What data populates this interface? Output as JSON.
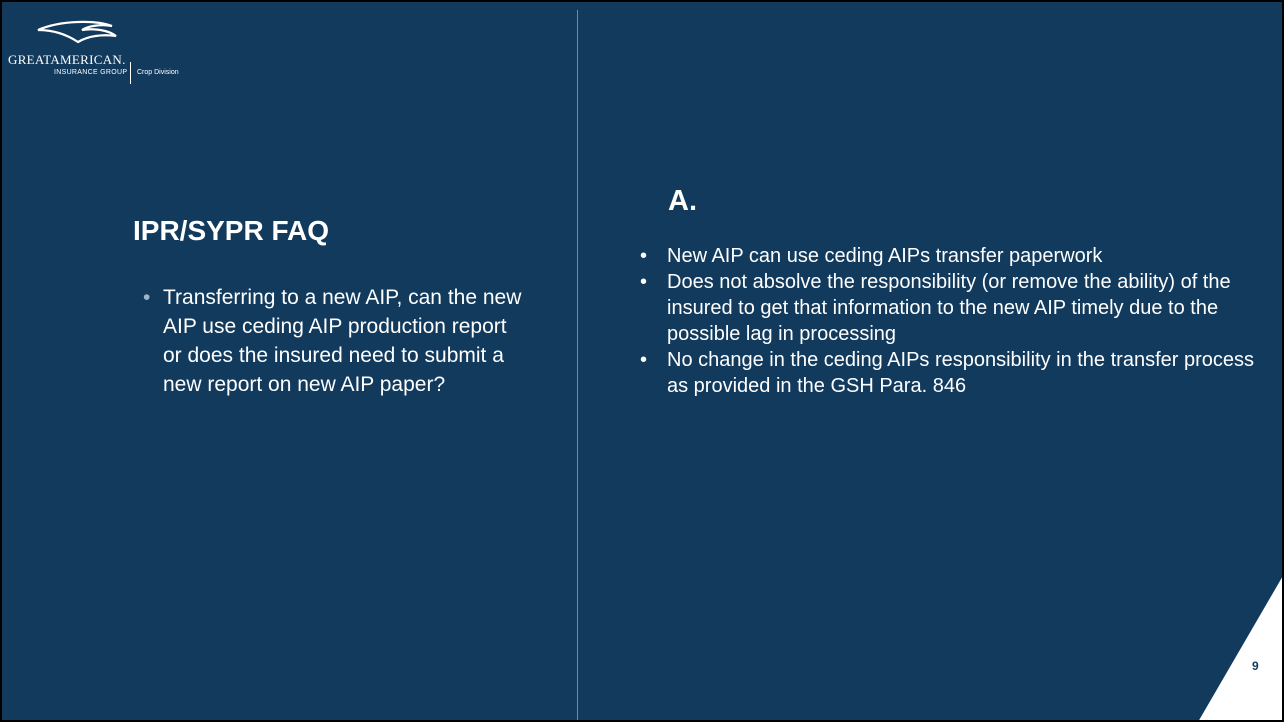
{
  "logo": {
    "name": "GREATAMERICAN.",
    "subtitle": "INSURANCE GROUP",
    "division": "Crop Division"
  },
  "left": {
    "title": "IPR/SYPR FAQ",
    "question": "Transferring to a new AIP, can the new AIP use ceding AIP production report or does the insured need to submit a new report on new AIP paper?"
  },
  "right": {
    "heading": "A.",
    "bullets": [
      "New AIP can use ceding AIPs transfer paperwork",
      "Does not absolve the responsibility (or remove the ability) of the insured to get that information to the new AIP timely due to the possible lag in processing",
      "No change in the ceding AIPs responsibility in the transfer process as provided in the GSH Para. 846"
    ]
  },
  "page_number": "9",
  "colors": {
    "background": "#113a5d",
    "text": "#ffffff",
    "divider": "#6f8aa4",
    "corner": "#ffffff"
  }
}
